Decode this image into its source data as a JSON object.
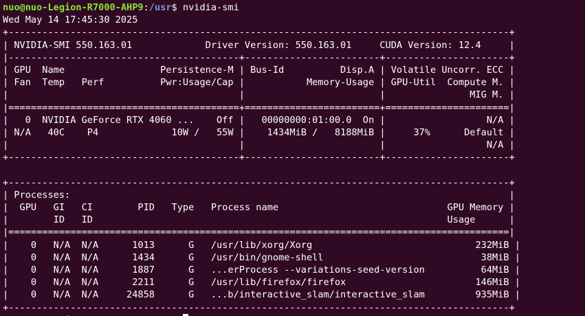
{
  "prompt": {
    "user_host": "nuo@nuo-Legion-R7000-AHP9",
    "sep": ":",
    "path": "/usr",
    "symbol": "$ ",
    "command": "nvidia-smi"
  },
  "timestamp": "Wed May 14 17:45:30 2025",
  "output_lines": [
    "+-----------------------------------------------------------------------------------------+",
    "| NVIDIA-SMI 550.163.01             Driver Version: 550.163.01     CUDA Version: 12.4     |",
    "|-----------------------------------------+------------------------+----------------------+",
    "| GPU  Name                 Persistence-M | Bus-Id          Disp.A | Volatile Uncorr. ECC |",
    "| Fan  Temp   Perf          Pwr:Usage/Cap |           Memory-Usage | GPU-Util  Compute M. |",
    "|                                         |                        |               MIG M. |",
    "|=========================================+========================+======================|",
    "|   0  NVIDIA GeForce RTX 4060 ...    Off |   00000000:01:00.0  On |                  N/A |",
    "| N/A   40C    P4             10W /   55W |    1434MiB /   8188MiB |     37%      Default |",
    "|                                         |                        |                  N/A |",
    "+-----------------------------------------+------------------------+----------------------+",
    "",
    "+-----------------------------------------------------------------------------------------+",
    "| Processes:                                                                              |",
    "|  GPU   GI   CI        PID   Type   Process name                              GPU Memory |",
    "|        ID   ID                                                               Usage      |",
    "|=========================================================================================|",
    "|    0   N/A  N/A      1013      G   /usr/lib/xorg/Xorg                             232MiB |",
    "|    0   N/A  N/A      1434      G   /usr/bin/gnome-shell                            38MiB |",
    "|    0   N/A  N/A      1887      G   ...erProcess --variations-seed-version          64MiB |",
    "|    0   N/A  N/A      2211      G   /usr/lib/firefox/firefox                       146MiB |",
    "|    0   N/A  N/A     24858      G   ...b/interactive_slam/interactive_slam         935MiB |",
    "+-----------------------------------------------------------------------------------------+"
  ]
}
